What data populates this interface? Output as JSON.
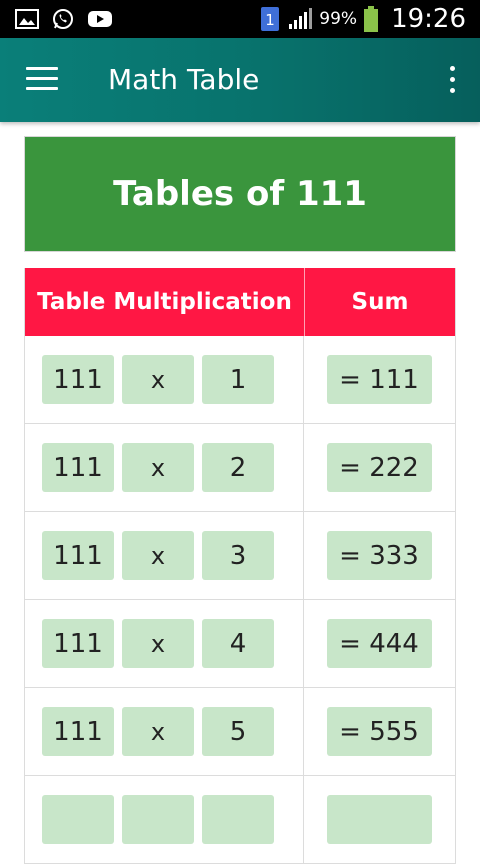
{
  "status_bar": {
    "battery": "99%",
    "time": "19:26",
    "notification_badge": "1"
  },
  "app_bar": {
    "title": "Math Table"
  },
  "header": {
    "title": "Tables of 111"
  },
  "table": {
    "headers": [
      "Table Multiplication",
      "Sum"
    ],
    "rows": [
      {
        "multiplicand": "111",
        "operator": "x",
        "multiplier": "1",
        "result": "= 111"
      },
      {
        "multiplicand": "111",
        "operator": "x",
        "multiplier": "2",
        "result": "= 222"
      },
      {
        "multiplicand": "111",
        "operator": "x",
        "multiplier": "3",
        "result": "= 333"
      },
      {
        "multiplicand": "111",
        "operator": "x",
        "multiplier": "4",
        "result": "= 444"
      },
      {
        "multiplicand": "111",
        "operator": "x",
        "multiplier": "5",
        "result": "= 555"
      },
      {
        "multiplicand": "",
        "operator": "",
        "multiplier": "",
        "result": ""
      }
    ]
  },
  "colors": {
    "app_bar": "#08726c",
    "header_card": "#3a953d",
    "table_header": "#ff1744",
    "chip": "#c8e6c9"
  }
}
